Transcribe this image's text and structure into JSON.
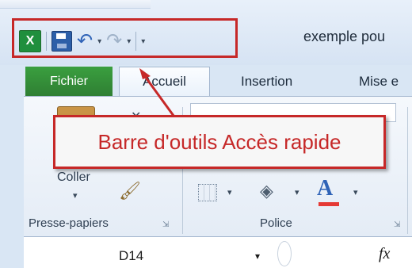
{
  "window": {
    "title": "exemple pou"
  },
  "qat": {
    "app_icon": "excel-icon",
    "app_icon_glyph": "X",
    "save_icon": "save-icon",
    "undo_icon": "undo-icon",
    "undo_glyph": "↶",
    "redo_icon": "redo-icon",
    "redo_glyph": "↷",
    "dropdown_glyph": "▾",
    "customize_glyph": "⊤"
  },
  "tabs": [
    {
      "label": "Fichier"
    },
    {
      "label": "Accueil"
    },
    {
      "label": "Insertion"
    },
    {
      "label": "Mise e"
    }
  ],
  "ribbon": {
    "paste_label": "Coller",
    "cut_glyph": "✕",
    "brush_glyph": "🖌",
    "dropdown_glyph": "▾",
    "groups": [
      {
        "label": "Presse-papiers",
        "launcher": "⇲"
      },
      {
        "label": "Police",
        "launcher": "⇲"
      }
    ],
    "fill_glyph": "◈",
    "font_color_glyph": "A"
  },
  "formula_bar": {
    "cell_ref": "D14",
    "fx_label": "fx"
  },
  "callout": {
    "text": "Barre d'outils Accès rapide"
  },
  "colors": {
    "callout_red": "#c62828",
    "file_tab_green": "#2f7f33",
    "ribbon_bg": "#e4ecf6"
  }
}
